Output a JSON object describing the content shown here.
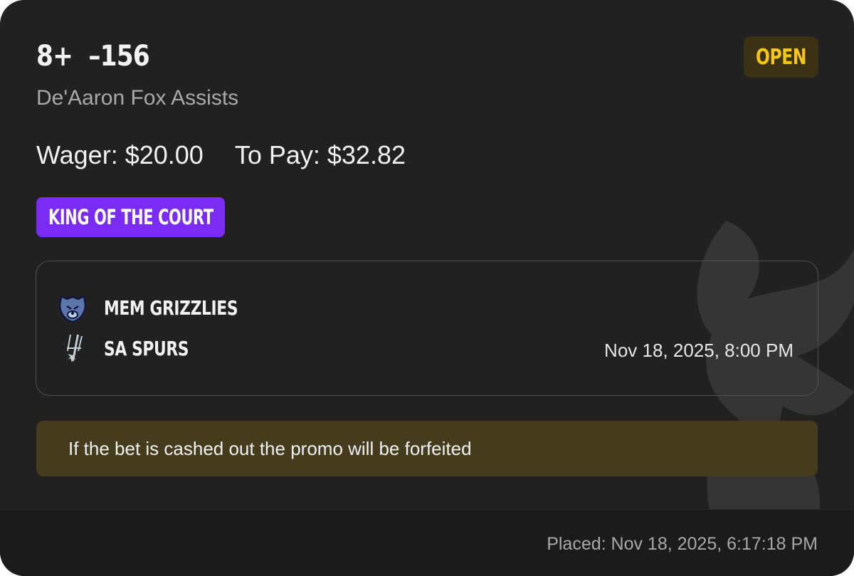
{
  "bet": {
    "line": "8+",
    "odds": "–156",
    "market": "De'Aaron Fox Assists",
    "status": "OPEN",
    "wager_text": "Wager: $20.00",
    "to_pay_text": "To Pay: $32.82",
    "promo_label": "KING OF THE COURT"
  },
  "game": {
    "teams": [
      {
        "name": "MEM GRIZZLIES",
        "logo": "grizzlies-logo"
      },
      {
        "name": "SA SPURS",
        "logo": "spurs-logo"
      }
    ],
    "start_time": "Nov 18, 2025, 8:00 PM"
  },
  "notice": {
    "text": "If the bet is cashed out the promo will be forfeited"
  },
  "footer": {
    "placed_text": "Placed: Nov 18, 2025, 6:17:18 PM"
  },
  "colors": {
    "card_bg": "#212121",
    "status_text": "#f5c518",
    "status_bg": "#3b3215",
    "promo_bg": "#7a2cf5",
    "notice_bg": "#453c1e"
  }
}
